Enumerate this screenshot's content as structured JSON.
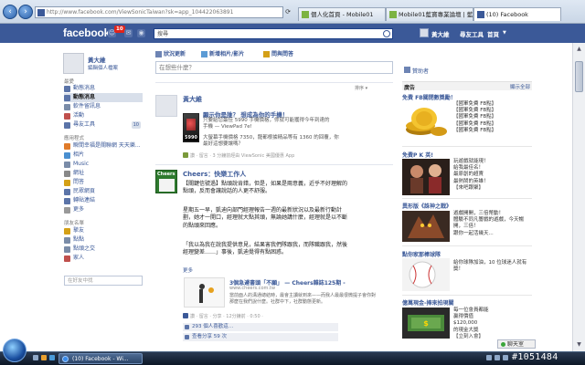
{
  "browser": {
    "url": "http://www.facebook.com/ViewSonicTaiwan?sk=app_104422063891",
    "tabs": [
      {
        "label": "個人化首頁 - Mobile01",
        "icon": "mobile01-icon",
        "color": "#7cb342"
      },
      {
        "label": "Mobile01藍寶專業論壇 | 藍",
        "icon": "mobile01-icon",
        "color": "#7cb342"
      },
      {
        "label": "(10) Facebook",
        "icon": "facebook-icon",
        "color": "#3b5998"
      }
    ]
  },
  "header": {
    "logo": "facebook",
    "notification_count": "10",
    "search_value": "搜尋",
    "user_name": "黃大維",
    "find_friends": "尋友工具",
    "home": "首頁"
  },
  "sidebar": {
    "name": "黃大維",
    "edit_profile": "編輯個人檔案",
    "favorites_head": "最愛",
    "favorites": [
      {
        "label": "動態消息",
        "selected": false,
        "color": "#5b74a8"
      },
      {
        "label": "動態消息",
        "selected": true,
        "color": "#5b74a8"
      },
      {
        "label": "軟件留訊息",
        "selected": false,
        "color": "#7a8ca8"
      },
      {
        "label": "活動",
        "selected": false,
        "color": "#c0504d"
      },
      {
        "label": "尋友工具",
        "selected": false,
        "color": "#5b74a8",
        "count": "10"
      }
    ],
    "apps_head": "應用程式",
    "apps": [
      {
        "label": "瞬間幸福是關聯網 天天樂...",
        "color": "#e07b2a"
      },
      {
        "label": "相片",
        "color": "#4a8fd0"
      },
      {
        "label": "Music",
        "color": "#7a8ca8"
      },
      {
        "label": "網址",
        "color": "#888"
      },
      {
        "label": "問答",
        "color": "#d4a017"
      },
      {
        "label": "民眾網頁",
        "color": "#5b74a8"
      },
      {
        "label": "轉貼連結",
        "color": "#5b74a8"
      },
      {
        "label": "更多",
        "color": "#999"
      }
    ],
    "friends_head": "朋友名單",
    "friends": [
      {
        "label": "摯友",
        "color": "#d4a017"
      },
      {
        "label": "點點",
        "color": "#7a8ca8"
      },
      {
        "label": "點頭之交",
        "color": "#7a8ca8"
      },
      {
        "label": "家人",
        "color": "#c0504d"
      }
    ],
    "friend_search_placeholder": "在好友中找"
  },
  "composer": {
    "tabs": [
      "狀況更新",
      "新增相片/影片",
      "問與問答"
    ],
    "placeholder": "在想些什麼？"
  },
  "feed": {
    "sort_label": "排序 ▾",
    "story1": {
      "author": "黃大維",
      "app_title": "顯示你是誰？ 想成為你的手機！",
      "app_desc": "只要給您最佳 5990 手機價格，你就可能獲得今年到達的手機 — ViewPad 7e!",
      "app_desc2": "大螢幕手機價格 7350，龍都根據精品等有 1360 的回覆，你最好這想要讓嗎？",
      "price": "5990",
      "meta": "讚 · 留言 · 3 分鐘前經由 ViewSonic 美國優惠 App"
    },
    "story2": {
      "author": "Cheers：快樂工作人",
      "logo_text": "Cheers",
      "paragraphs": [
        "【關鍵信號過】點頭說肯錯，但是，如果是兩意義，近乎不好理解的點頭，反而會讓說話的人更不舒服。",
        "星期五一早，凱迪向部門經理報告一週的最新狀況以及最新行動計劃，她才一開口，經理就大點其頭，無論她講什麼，經理就是以不斷的點頭來回應。",
        "「我以為我在說我提供意見，結果害我們隊跟我，而隊職跟我，然後經理變差……」事後，凱迪覺得有點困惑。"
      ],
      "more": "更多",
      "share_title": "3個急遽書頭「不願」 — Cheers雜誌125期 -",
      "share_url": "www.cheers.com.tw",
      "share_desc": "當前面人的溝通總結時，最會主讀就到來——而我人最最很微提子會你對那麼在我們說什麼。社群中下，社群動態更新。",
      "meta": "讚 · 留言 · 分享 · 12分鐘前 · 0:50 ·",
      "likes": "293 個人喜歡這…",
      "shares": "查看分享 59 次"
    }
  },
  "right": {
    "head": "贊助者",
    "ads_label": "廣告",
    "create_ad": "顯示全部",
    "ads": [
      {
        "title": "免費 FB關閉數獎勵！",
        "img": "gold-coins",
        "text": "【國軍免費 FB點】\n【國軍免費 FB點】\n【國軍免費 FB點】\n【國軍免費 FB點】\n【國軍免費 FB點】"
      },
      {
        "title": "免費P K 英!",
        "img": "game-characters",
        "text": "玩遊戲就能現！\n給我最佳名！\n最原創的超賣\n最熱鬧的英雄！\n【來吧跟聚】"
      },
      {
        "title": "異形版《誅神之戰》",
        "img": "monster",
        "text": "遊戲開開，三倍幣動！\n體驗不同凡響戲的遊戲，今天暢開，三倍！\n跟你一起活幾天..."
      },
      {
        "title": "點你家那棒球隊",
        "img": "baseball",
        "text": "給你球隊加油，10 位球迷人就有獎！"
      },
      {
        "title": "億萬現金-捧來拍現關",
        "img": "cash",
        "text": "每一位會員都能\n贏得價值\n$120,000\n的現金大獎\n【立刻入會】"
      }
    ],
    "chat": "聊天室"
  },
  "taskbar": {
    "task": "(10) Facebook - Wi...",
    "watermark": "#1051484"
  }
}
